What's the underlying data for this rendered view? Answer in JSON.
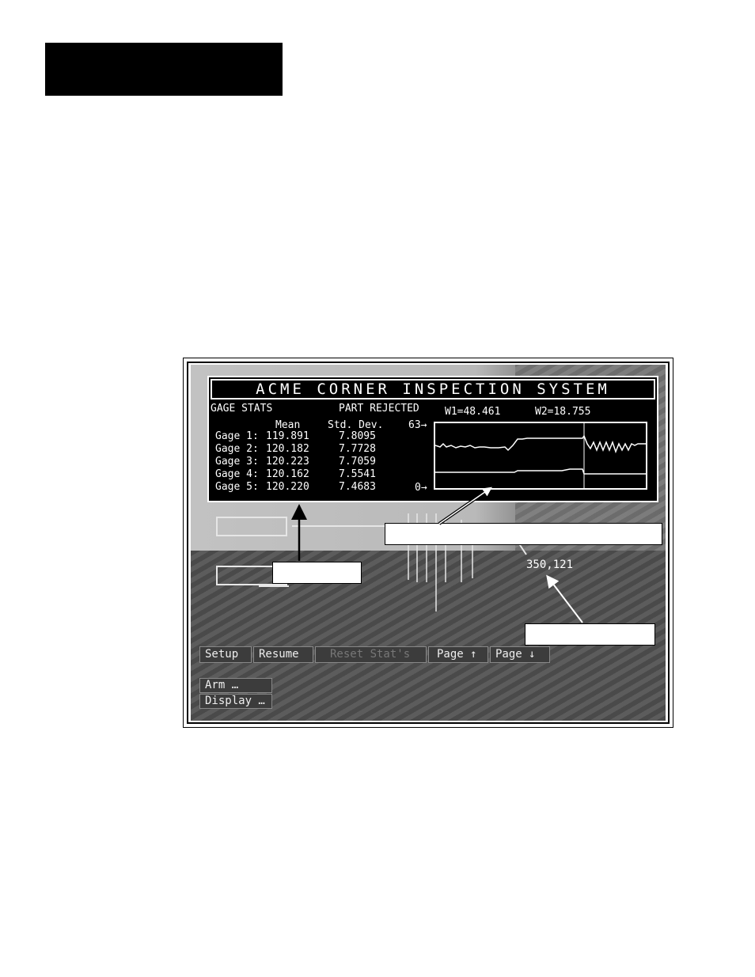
{
  "screen": {
    "title": "ACME CORNER INSPECTION SYSTEM",
    "gage_stats_label": "GAGE STATS",
    "part_status": "PART REJECTED",
    "w1": "W1=48.461",
    "w2": "W2=18.755",
    "col_mean": "Mean",
    "col_std": "Std. Dev.",
    "scale_top": "63→",
    "scale_bottom": "0→",
    "gages": [
      {
        "label": "Gage 1:",
        "mean": "119.891",
        "std": "7.8095"
      },
      {
        "label": "Gage 2:",
        "mean": "120.182",
        "std": "7.7728"
      },
      {
        "label": "Gage 3:",
        "mean": "120.223",
        "std": "7.7059"
      },
      {
        "label": "Gage 4:",
        "mean": "120.162",
        "std": "7.5541"
      },
      {
        "label": "Gage 5:",
        "mean": "120.220",
        "std": "7.4683"
      }
    ],
    "coordinate": "350,121"
  },
  "toolbar": {
    "setup": "Setup",
    "resume": "Resume",
    "reset": "Reset Stat's",
    "page_up": "Page ↑",
    "page_down": "Page ↓"
  },
  "menu": {
    "arm": "Arm       …",
    "display": "Display  …"
  },
  "colors": {
    "panel": "#000000",
    "text": "#ffffff"
  }
}
